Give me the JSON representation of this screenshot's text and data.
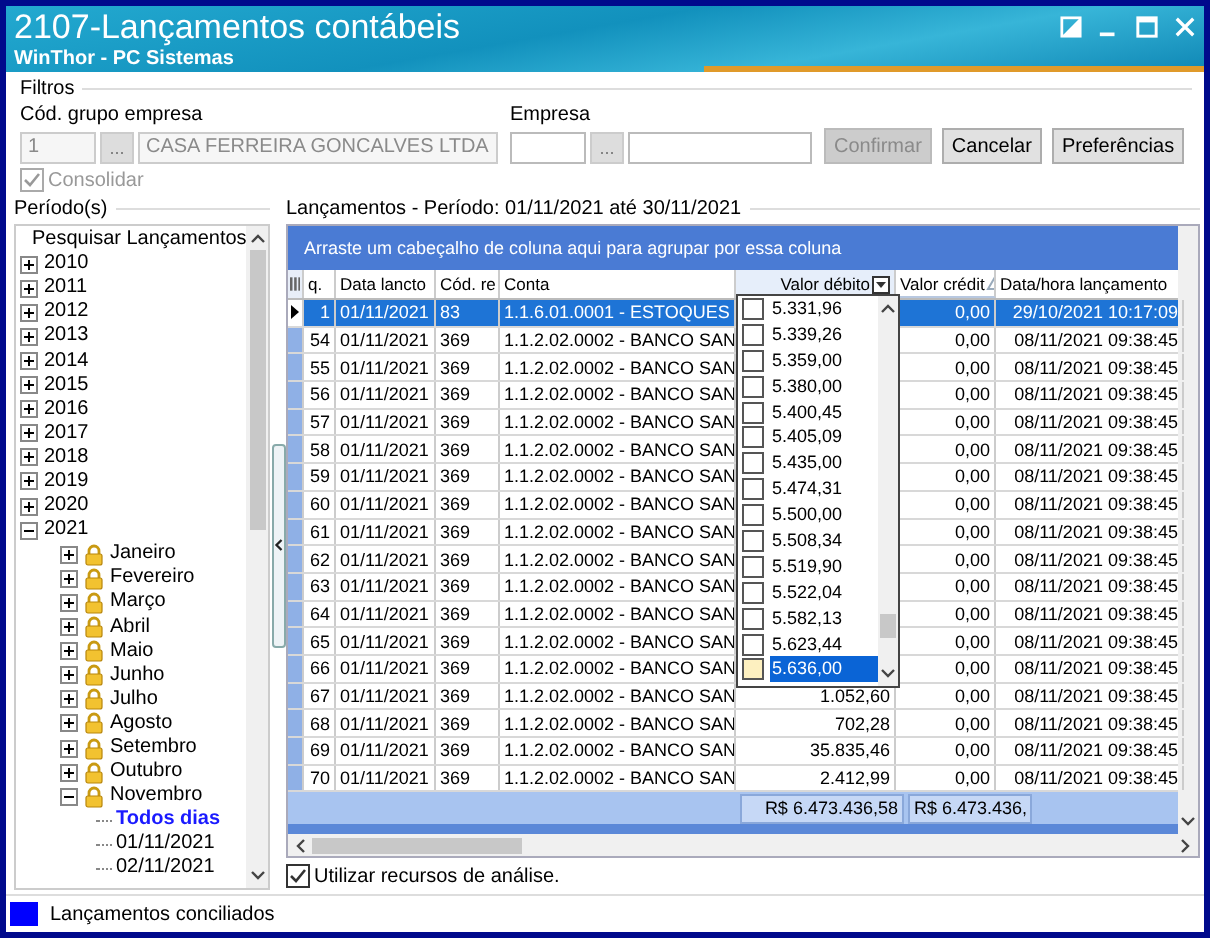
{
  "window": {
    "title": "2107-Lançamentos contábeis",
    "subtitle": "WinThor - PC Sistemas"
  },
  "filters": {
    "title": "Filtros",
    "fields": [
      {
        "label": "Cód. grupo empresa",
        "browse": "...",
        "code": {
          "value": "1",
          "disabled": true
        },
        "name": {
          "value": "CASA FERREIRA GONCALVES LTDA",
          "disabled": true
        }
      },
      {
        "label": "Empresa",
        "browse": "...",
        "code": {
          "disabled": false
        },
        "name": {
          "disabled": false
        }
      }
    ],
    "buttons": [
      {
        "label": "Confirmar",
        "disabled": true
      },
      {
        "label": "Cancelar",
        "disabled": false
      },
      {
        "label": "Preferências",
        "disabled": false
      }
    ],
    "consolidate": {
      "label": "Consolidar",
      "checked": true,
      "disabled": true
    }
  },
  "periods": {
    "title": "Período(s)",
    "tree": {
      "label": "Pesquisar Lançamentos",
      "selected": false,
      "children": [
        {
          "label": "2010",
          "expanded": false,
          "selected": false
        },
        {
          "label": "2011",
          "expanded": false,
          "selected": false
        },
        {
          "label": "2012",
          "expanded": false,
          "selected": false
        },
        {
          "label": "2013",
          "expanded": false,
          "selected": false
        },
        {
          "label": "2014",
          "expanded": false,
          "selected": false
        },
        {
          "label": "2015",
          "expanded": false,
          "selected": false
        },
        {
          "label": "2016",
          "expanded": false,
          "selected": false
        },
        {
          "label": "2017",
          "expanded": false,
          "selected": false
        },
        {
          "label": "2018",
          "expanded": false,
          "selected": false
        },
        {
          "label": "2019",
          "expanded": false,
          "selected": false
        },
        {
          "label": "2020",
          "expanded": false,
          "selected": false
        },
        {
          "label": "2021",
          "expanded": true,
          "selected": false,
          "children": [
            {
              "label": "Janeiro",
              "expanded": false,
              "selected": false
            },
            {
              "label": "Fevereiro",
              "expanded": false,
              "selected": false
            },
            {
              "label": "Março",
              "expanded": false,
              "selected": false
            },
            {
              "label": "Abril",
              "expanded": false,
              "selected": false
            },
            {
              "label": "Maio",
              "expanded": false,
              "selected": false
            },
            {
              "label": "Junho",
              "expanded": false,
              "selected": false
            },
            {
              "label": "Julho",
              "expanded": false,
              "selected": false
            },
            {
              "label": "Agosto",
              "expanded": false,
              "selected": false
            },
            {
              "label": "Setembro",
              "expanded": false,
              "selected": false
            },
            {
              "label": "Outubro",
              "expanded": false,
              "selected": false
            },
            {
              "label": "Novembro",
              "expanded": true,
              "selected": false,
              "children": [
                {
                  "label": "Todos dias",
                  "selected": true
                },
                {
                  "label": "01/11/2021",
                  "selected": false
                },
                {
                  "label": "02/11/2021",
                  "selected": false
                }
              ]
            }
          ]
        }
      ]
    }
  },
  "entries": {
    "title": "Lançamentos - Período: 01/11/2021 até 30/11/2021",
    "group_hint": "Arraste um cabeçalho de coluna aqui para agrupar por essa coluna",
    "columns": [
      {
        "label": "q.",
        "filtered": false,
        "sorted": false
      },
      {
        "label": "Data lancto",
        "filtered": false,
        "sorted": false
      },
      {
        "label": "Cód. re",
        "filtered": false,
        "sorted": false
      },
      {
        "label": "Conta",
        "filtered": false,
        "sorted": false
      },
      {
        "label": "Valor débito",
        "filtered": true,
        "sorted": false
      },
      {
        "label": "Valor crédit",
        "filtered": false,
        "sorted": true
      },
      {
        "label": "Data/hora lançamento",
        "filtered": false,
        "sorted": false
      }
    ],
    "rows": [
      {
        "seq": "1",
        "date": "01/11/2021",
        "code": "83",
        "account": "1.1.6.01.0001 - ESTOQUES",
        "credit": "0,00",
        "timestamp": "29/10/2021 10:17:09",
        "selected": true
      },
      {
        "seq": "54",
        "date": "01/11/2021",
        "code": "369",
        "account": "1.1.2.02.0002 - BANCO SAN",
        "credit": "0,00",
        "timestamp": "08/11/2021 09:38:45",
        "selected": false
      },
      {
        "seq": "55",
        "date": "01/11/2021",
        "code": "369",
        "account": "1.1.2.02.0002 - BANCO SAN",
        "credit": "0,00",
        "timestamp": "08/11/2021 09:38:45",
        "selected": false
      },
      {
        "seq": "56",
        "date": "01/11/2021",
        "code": "369",
        "account": "1.1.2.02.0002 - BANCO SAN",
        "credit": "0,00",
        "timestamp": "08/11/2021 09:38:45",
        "selected": false
      },
      {
        "seq": "57",
        "date": "01/11/2021",
        "code": "369",
        "account": "1.1.2.02.0002 - BANCO SAN",
        "credit": "0,00",
        "timestamp": "08/11/2021 09:38:45",
        "selected": false
      },
      {
        "seq": "58",
        "date": "01/11/2021",
        "code": "369",
        "account": "1.1.2.02.0002 - BANCO SAN",
        "credit": "0,00",
        "timestamp": "08/11/2021 09:38:45",
        "selected": false
      },
      {
        "seq": "59",
        "date": "01/11/2021",
        "code": "369",
        "account": "1.1.2.02.0002 - BANCO SAN",
        "credit": "0,00",
        "timestamp": "08/11/2021 09:38:45",
        "selected": false
      },
      {
        "seq": "60",
        "date": "01/11/2021",
        "code": "369",
        "account": "1.1.2.02.0002 - BANCO SAN",
        "credit": "0,00",
        "timestamp": "08/11/2021 09:38:45",
        "selected": false
      },
      {
        "seq": "61",
        "date": "01/11/2021",
        "code": "369",
        "account": "1.1.2.02.0002 - BANCO SAN",
        "credit": "0,00",
        "timestamp": "08/11/2021 09:38:45",
        "selected": false
      },
      {
        "seq": "62",
        "date": "01/11/2021",
        "code": "369",
        "account": "1.1.2.02.0002 - BANCO SAN",
        "credit": "0,00",
        "timestamp": "08/11/2021 09:38:45",
        "selected": false
      },
      {
        "seq": "63",
        "date": "01/11/2021",
        "code": "369",
        "account": "1.1.2.02.0002 - BANCO SAN",
        "credit": "0,00",
        "timestamp": "08/11/2021 09:38:45",
        "selected": false
      },
      {
        "seq": "64",
        "date": "01/11/2021",
        "code": "369",
        "account": "1.1.2.02.0002 - BANCO SAN",
        "credit": "0,00",
        "timestamp": "08/11/2021 09:38:45",
        "selected": false
      },
      {
        "seq": "65",
        "date": "01/11/2021",
        "code": "369",
        "account": "1.1.2.02.0002 - BANCO SAN",
        "credit": "0,00",
        "timestamp": "08/11/2021 09:38:45",
        "selected": false
      },
      {
        "seq": "66",
        "date": "01/11/2021",
        "code": "369",
        "account": "1.1.2.02.0002 - BANCO SAN",
        "credit": "0,00",
        "timestamp": "08/11/2021 09:38:45",
        "selected": false
      },
      {
        "seq": "67",
        "date": "01/11/2021",
        "code": "369",
        "account": "1.1.2.02.0002 - BANCO SAN",
        "debit": "1.052,60",
        "credit": "0,00",
        "timestamp": "08/11/2021 09:38:45",
        "selected": false
      },
      {
        "seq": "68",
        "date": "01/11/2021",
        "code": "369",
        "account": "1.1.2.02.0002 - BANCO SAN",
        "debit": "702,28",
        "credit": "0,00",
        "timestamp": "08/11/2021 09:38:45",
        "selected": false
      },
      {
        "seq": "69",
        "date": "01/11/2021",
        "code": "369",
        "account": "1.1.2.02.0002 - BANCO SAN",
        "debit": "35.835,46",
        "credit": "0,00",
        "timestamp": "08/11/2021 09:38:45",
        "selected": false
      },
      {
        "seq": "70",
        "date": "01/11/2021",
        "code": "369",
        "account": "1.1.2.02.0002 - BANCO SAN",
        "debit": "2.412,99",
        "credit": "0,00",
        "timestamp": "08/11/2021 09:38:45",
        "selected": false
      }
    ],
    "totals": [
      "R$ 6.473.436,58",
      "R$ 6.473.436,"
    ],
    "filter_popup": {
      "items": [
        {
          "value": "5.331,96",
          "checked": false,
          "selected": false
        },
        {
          "value": "5.339,26",
          "checked": false,
          "selected": false
        },
        {
          "value": "5.359,00",
          "checked": false,
          "selected": false
        },
        {
          "value": "5.380,00",
          "checked": false,
          "selected": false
        },
        {
          "value": "5.400,45",
          "checked": false,
          "selected": false
        },
        {
          "value": "5.405,09",
          "checked": false,
          "selected": false
        },
        {
          "value": "5.435,00",
          "checked": false,
          "selected": false
        },
        {
          "value": "5.474,31",
          "checked": false,
          "selected": false
        },
        {
          "value": "5.500,00",
          "checked": false,
          "selected": false
        },
        {
          "value": "5.508,34",
          "checked": false,
          "selected": false
        },
        {
          "value": "5.519,90",
          "checked": false,
          "selected": false
        },
        {
          "value": "5.522,04",
          "checked": false,
          "selected": false
        },
        {
          "value": "5.582,13",
          "checked": false,
          "selected": false
        },
        {
          "value": "5.623,44",
          "checked": false,
          "selected": false
        },
        {
          "value": "5.636,00",
          "checked": false,
          "selected": true
        }
      ]
    },
    "analysis": {
      "label": "Utilizar recursos de análise.",
      "checked": true
    }
  },
  "status_bar": {
    "legend": "Lançamentos conciliados",
    "color": "#0000ff"
  }
}
